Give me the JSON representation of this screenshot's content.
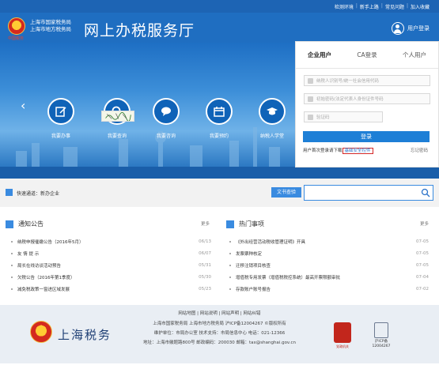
{
  "top_links": [
    "检测环境",
    "新手上路",
    "常见问题",
    "加入收藏"
  ],
  "header": {
    "emblem_caption": "中国税务",
    "bureau_lines": [
      "上海市国家税务局",
      "上海市地方税务局"
    ],
    "site_title": "网上办税服务厅",
    "user_login": "用户登录"
  },
  "banner_buttons": [
    {
      "label": "我要办事",
      "icon": "edit-icon"
    },
    {
      "label": "我要查询",
      "icon": "search-icon"
    },
    {
      "label": "我要咨询",
      "icon": "chat-icon"
    },
    {
      "label": "我要预约",
      "icon": "calendar-icon"
    },
    {
      "label": "纳税人学堂",
      "icon": "graduation-cap-icon"
    }
  ],
  "login": {
    "tabs": [
      "企业用户",
      "CA登录",
      "个人用户"
    ],
    "active_tab": "企业用户",
    "taxpayer_placeholder": "纳税人识别号/统一社会信用代码",
    "password_placeholder": "初始密码(法定代表人身份证件号码",
    "captcha_placeholder": "验证码",
    "submit": "登录",
    "first_login_prefix": "用户首次登录请下载",
    "first_login_link": "基础安全控件",
    "forgot_password": "忘记密码"
  },
  "quick": {
    "label": "快速通道：新办企业",
    "search_button": "文书查验"
  },
  "notices": {
    "title": "通知公告",
    "more": "更多",
    "items": [
      {
        "title": "纳税申报催缴公告（2016年5月）",
        "date": "06/13"
      },
      {
        "title": "友 情 提 示",
        "date": "06/07"
      },
      {
        "title": "局长在线访谈活动预告",
        "date": "05/31"
      },
      {
        "title": "欠税公告（2016年第1季度）",
        "date": "05/30"
      },
      {
        "title": "减免税政策一窗进区域发展",
        "date": "05/23"
      }
    ]
  },
  "hot": {
    "title": "热门事项",
    "more": "更多",
    "items": [
      {
        "title": "《外出经营活动税收管理证明》开具",
        "date": "07-05"
      },
      {
        "title": "发票票种核定",
        "date": "07-05"
      },
      {
        "title": "迁移注销项目核查",
        "date": "07-05"
      },
      {
        "title": "增值税专用发票（增值税税控系统）最高开票限额审批",
        "date": "07-04"
      },
      {
        "title": "存款账户账号报告",
        "date": "07-02"
      }
    ]
  },
  "footer": {
    "links": [
      "网站地图",
      "网站说明",
      "网站声明",
      "网站纠错"
    ],
    "brand": "上海税务",
    "line1": "上海市国家税务局 上海市地方税务局 沪ICP备12004267 ©版权所有",
    "line2": "维护单位：市局办公室 技术支持：市局信息中心 电话：021-12366",
    "line3": "地址：上海市徽题路800号 邮政编码：200030 邮箱：tax@shanghai.gov.cn",
    "badge_red_label": "党政机关",
    "icp_label": "沪ICP备",
    "icp_number": "12004267"
  },
  "colors": {
    "header_blue": "#1f6ec1",
    "topbar_blue": "#1d64b4",
    "button_blue": "#1e7fd6",
    "highlight_red": "#d32626"
  }
}
